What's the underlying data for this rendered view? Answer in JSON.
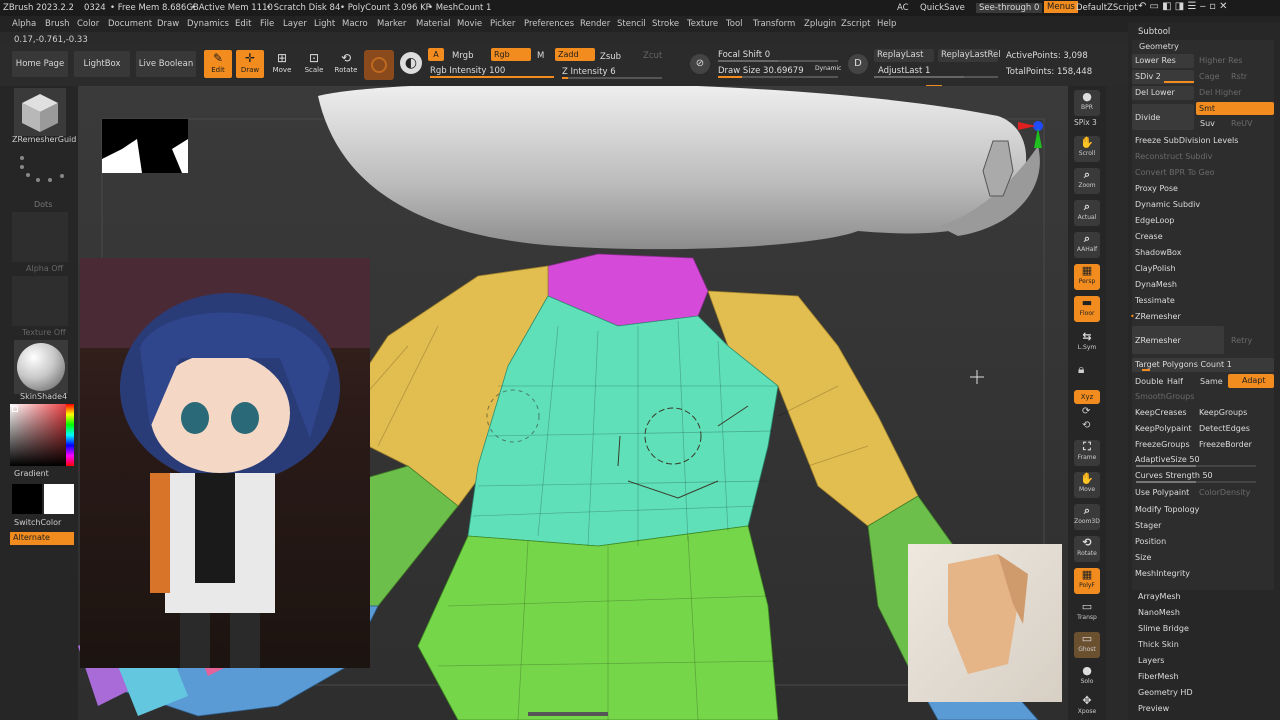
{
  "titlebar": {
    "app": "ZBrush 2023.2.2",
    "id": "0324",
    "free_mem": "• Free Mem 8.686GB",
    "active_mem": "• Active Mem 1110",
    "scratch": "• Scratch Disk 84",
    "polycount": "• PolyCount 3.096 KP",
    "meshcount": "• MeshCount 1",
    "ac": "AC",
    "quicksave": "QuickSave",
    "seethrough": "See-through  0",
    "menus": "Menus",
    "script": "DefaultZScript"
  },
  "menu": [
    "Alpha",
    "Brush",
    "Color",
    "Document",
    "Draw",
    "Dynamics",
    "Edit",
    "File",
    "Layer",
    "Light",
    "Macro",
    "Marker",
    "Material",
    "Movie",
    "Picker",
    "Preferences",
    "Render",
    "Stencil",
    "Stroke",
    "Texture",
    "Tool",
    "Transform",
    "Zplugin",
    "Zscript",
    "Help"
  ],
  "coords": "0.17,-0.761,-0.33",
  "toolbar": {
    "home": "Home Page",
    "lightbox": "LightBox",
    "live_boolean": "Live Boolean",
    "edit": "Edit",
    "draw": "Draw",
    "move": "Move",
    "scale": "Scale",
    "rotate": "Rotate",
    "a": "A",
    "mrgb": "Mrgb",
    "rgb": "Rgb",
    "m": "M",
    "zadd": "Zadd",
    "zsub": "Zsub",
    "zcut": "Zcut",
    "rgb_intensity": "Rgb Intensity 100",
    "z_intensity": "Z Intensity 6",
    "focal_shift": "Focal Shift 0",
    "draw_size": "Draw Size 30.69679",
    "dynamic": "Dynamic",
    "replay_last": "ReplayLast",
    "replay_last_rel": "ReplayLastRel",
    "adjust_last": "AdjustLast 1",
    "active_points": "ActivePoints: 3,098",
    "total_points": "TotalPoints: 158,448"
  },
  "left": {
    "tool_label": "ZRemesherGuid",
    "dots": "Dots",
    "alpha_off": "Alpha Off",
    "texture_off": "Texture Off",
    "material": "SkinShade4",
    "gradient": "Gradient",
    "switch_color": "SwitchColor",
    "alternate": "Alternate"
  },
  "right_shelf": [
    {
      "icon": "bpr-icon",
      "label": "BPR"
    },
    {
      "icon": "spix-icon",
      "label": "SPix 3"
    },
    {
      "icon": "scroll-icon",
      "label": "Scroll"
    },
    {
      "icon": "zoom-icon",
      "label": "Zoom"
    },
    {
      "icon": "actual-icon",
      "label": "Actual"
    },
    {
      "icon": "aahalf-icon",
      "label": "AAHalf"
    },
    {
      "icon": "persp-icon",
      "label": "Persp"
    },
    {
      "icon": "floor-icon",
      "label": "Floor"
    },
    {
      "icon": "lsym-icon",
      "label": "L.Sym"
    },
    {
      "icon": "xyz-icon",
      "label": "Xyz"
    },
    {
      "icon": "frame-icon",
      "label": "Frame"
    },
    {
      "icon": "move-icon",
      "label": "Move"
    },
    {
      "icon": "zoom3d-icon",
      "label": "Zoom3D"
    },
    {
      "icon": "rotate-icon",
      "label": "Rotate"
    },
    {
      "icon": "polyf-icon",
      "label": "PolyF"
    },
    {
      "icon": "transp-icon",
      "label": "Transp"
    },
    {
      "icon": "ghost-icon",
      "label": "Ghost"
    },
    {
      "icon": "solo-icon",
      "label": "Solo"
    },
    {
      "icon": "xpose-icon",
      "label": "Xpose"
    }
  ],
  "subtool": {
    "title": "Subtool",
    "geometry": "Geometry",
    "lower_res": "Lower Res",
    "higher_res": "Higher Res",
    "sdiv": "SDiv 2",
    "cage": "Cage",
    "rstr": "Rstr",
    "del_lower": "Del Lower",
    "del_higher": "Del Higher",
    "divide": "Divide",
    "smt": "Smt",
    "suv": "Suv",
    "reuv": "ReUV",
    "items": [
      "Freeze SubDivision Levels",
      "Reconstruct Subdiv",
      "Convert BPR To Geo",
      "Proxy Pose",
      "Dynamic Subdiv",
      "EdgeLoop",
      "Crease",
      "ShadowBox",
      "ClayPolish",
      "DynaMesh",
      "Tessimate",
      "ZRemesher"
    ],
    "zremesher_btn": "ZRemesher",
    "retry": "Retry",
    "target_poly": "Target Polygons Count 1",
    "double": "Double",
    "half": "Half",
    "same": "Same",
    "adapt": "Adapt",
    "smooth_groups": "SmoothGroups",
    "keep_creases": "KeepCreases",
    "keep_groups": "KeepGroups",
    "keep_polypaint": "KeepPolypaint",
    "detect_edges": "DetectEdges",
    "freeze_groups": "FreezeGroups",
    "freeze_border": "FreezeBorder",
    "adaptive_size": "AdaptiveSize 50",
    "curves_strength": "Curves Strength 50",
    "use_polypaint": "Use Polypaint",
    "color_density": "ColorDensity",
    "items2": [
      "Modify Topology",
      "Stager",
      "Position",
      "Size",
      "MeshIntegrity"
    ],
    "items3": [
      "ArrayMesh",
      "NanoMesh",
      "Slime Bridge",
      "Thick Skin",
      "Layers",
      "FiberMesh",
      "Geometry HD",
      "Preview"
    ]
  },
  "colors": {
    "accent": "#f28c1e",
    "neck": "#d54ad8",
    "torso": "#5fe0b9",
    "sleeve": "#e2bd4f",
    "forearm": "#6dbf4b",
    "lower_torso": "#76d64a",
    "hand": "#5b9bd5"
  }
}
